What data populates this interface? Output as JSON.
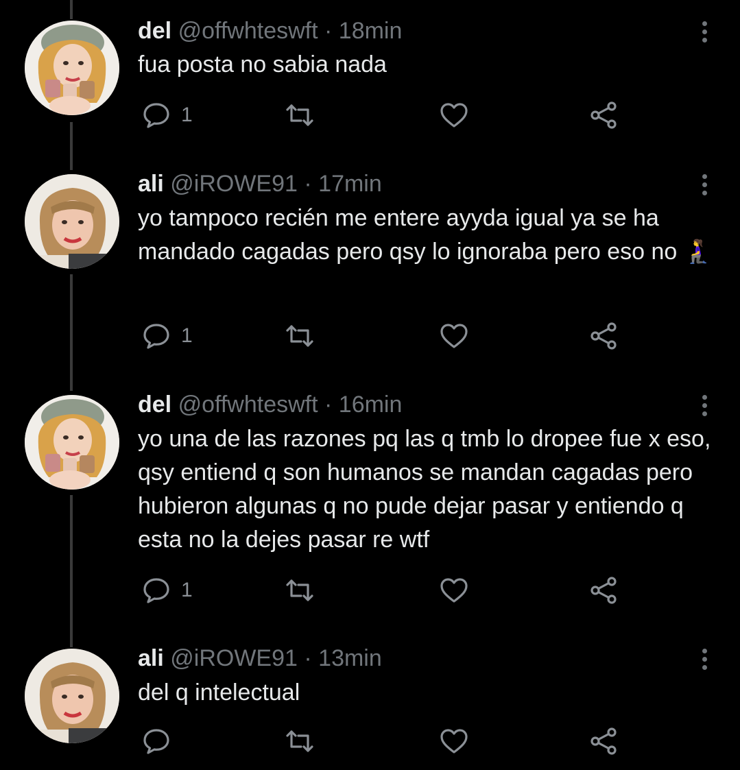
{
  "tweets": [
    {
      "name": "del",
      "handle": "@offwhteswft",
      "sep": "·",
      "time": "18min",
      "text": "fua posta no sabia nada",
      "reply_count": "1",
      "avatar": "avatar-del"
    },
    {
      "name": "ali",
      "handle": "@iROWE91",
      "sep": "·",
      "time": "17min",
      "text": "yo tampoco recién me entere ayyda igual ya se ha mandado cagadas pero qsy lo ignoraba pero eso no 🧎‍♀️",
      "reply_count": "1",
      "avatar": "avatar-ali"
    },
    {
      "name": "del",
      "handle": "@offwhteswft",
      "sep": "·",
      "time": "16min",
      "text": "yo una de las razones pq las q tmb lo dropee fue x eso, qsy entiend q son humanos se mandan cagadas pero hubieron algunas q no pude dejar pasar y entiendo q esta no la dejes pasar re wtf",
      "reply_count": "1",
      "avatar": "avatar-del"
    },
    {
      "name": "ali",
      "handle": "@iROWE91",
      "sep": "·",
      "time": "13min",
      "text": "del q intelectual",
      "reply_count": "",
      "avatar": "avatar-ali"
    }
  ],
  "colors": {
    "background": "#000000",
    "text": "#e7e9ea",
    "muted": "#71767b",
    "thread_line": "#3a3a3a"
  },
  "icons": [
    "reply-icon",
    "retweet-icon",
    "like-icon",
    "share-icon",
    "more-icon"
  ]
}
